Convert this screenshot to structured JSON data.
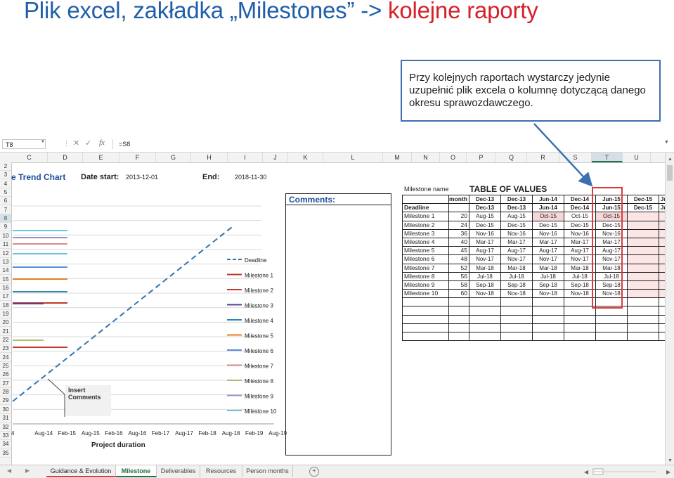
{
  "slide": {
    "title_part1": "Plik excel, zakładka „Milestones” ->",
    "title_part2": "kolejne raporty",
    "callout": "Przy kolejnych raportach wystarczy jedynie uzupełnić plik excela o kolumnę dotyczącą danego okresu sprawozdawczego."
  },
  "formula_bar": {
    "name_box": "T8",
    "fx": "fx",
    "formula": "=S8"
  },
  "columns": [
    "C",
    "D",
    "E",
    "F",
    "G",
    "H",
    "I",
    "J",
    "K",
    "L",
    "M",
    "N",
    "O",
    "P",
    "Q",
    "R",
    "S",
    "T",
    "U"
  ],
  "selected_column": "T",
  "rows": [
    "2",
    "3",
    "4",
    "5",
    "6",
    "7",
    "8",
    "9",
    "10",
    "11",
    "12",
    "13",
    "14",
    "15",
    "16",
    "17",
    "18",
    "19",
    "20",
    "21",
    "22",
    "23",
    "24",
    "25",
    "26",
    "27",
    "28",
    "29",
    "30",
    "31",
    "32",
    "33",
    "34",
    "35"
  ],
  "selected_row": "8",
  "chart": {
    "title": "e Trend Chart",
    "date_start_label": "Date start:",
    "date_start_value": "2013-12-01",
    "date_end_label": "End:",
    "date_end_value": "2018-11-30",
    "x_axis_title": "Project duration",
    "x_ticks": [
      "4",
      "Aug-14",
      "Feb-15",
      "Aug-15",
      "Feb-16",
      "Aug-16",
      "Feb-17",
      "Aug-17",
      "Feb-18",
      "Aug-18",
      "Feb-19",
      "Aug-19"
    ],
    "insert_label": "Insert Comments",
    "legend": [
      {
        "name": "Deadline",
        "color": "#2e75b6",
        "dashed": true
      },
      {
        "name": "Milestone 1",
        "color": "#c0392b"
      },
      {
        "name": "Milestone 2",
        "color": "#c0392b"
      },
      {
        "name": "Milestone 3",
        "color": "#5b3f8c"
      },
      {
        "name": "Milestone 4",
        "color": "#2a8aa8"
      },
      {
        "name": "Milestone 5",
        "color": "#e67e22"
      },
      {
        "name": "Milestone 6",
        "color": "#5b8ed6"
      },
      {
        "name": "Milestone 7",
        "color": "#d98a8a"
      },
      {
        "name": "Milestone 8",
        "color": "#a8c070"
      },
      {
        "name": "Milestone 9",
        "color": "#9b8fc8"
      },
      {
        "name": "Milestone 10",
        "color": "#6cc4d8"
      }
    ]
  },
  "comments": {
    "label": "Comments:"
  },
  "table": {
    "milestone_name_label": "Milestone name",
    "title": "TABLE OF VALUES",
    "header": [
      "",
      "month",
      "Dec-13",
      "Dec-13",
      "Jun-14",
      "Dec-14",
      "Jun-15",
      "Dec-15",
      "Ju"
    ],
    "rows": [
      [
        "Deadline",
        "",
        "Dec-13",
        "Dec-13",
        "Jun-14",
        "Dec-14",
        "Jun-15",
        "Dec-15",
        "Ju"
      ],
      [
        "Milestone 1",
        "20",
        "Aug-15",
        "Aug-15",
        "Oct-15",
        "Oct-15",
        "Oct-15",
        "",
        ""
      ],
      [
        "Milestone 2",
        "24",
        "Dec-15",
        "Dec-15",
        "Dec-15",
        "Dec-15",
        "Dec-15",
        "",
        ""
      ],
      [
        "Milestone 3",
        "36",
        "Nov-16",
        "Nov-16",
        "Nov-16",
        "Nov-16",
        "Nov-16",
        "",
        ""
      ],
      [
        "Milestone 4",
        "40",
        "Mar-17",
        "Mar-17",
        "Mar-17",
        "Mar-17",
        "Mar-17",
        "",
        ""
      ],
      [
        "Milestone 5",
        "45",
        "Aug-17",
        "Aug-17",
        "Aug-17",
        "Aug-17",
        "Aug-17",
        "",
        ""
      ],
      [
        "Milestone 6",
        "48",
        "Nov-17",
        "Nov-17",
        "Nov-17",
        "Nov-17",
        "Nov-17",
        "",
        ""
      ],
      [
        "Milestone 7",
        "52",
        "Mar-18",
        "Mar-18",
        "Mar-18",
        "Mar-18",
        "Mar-18",
        "",
        ""
      ],
      [
        "Milestone 8",
        "56",
        "Jul-18",
        "Jul-18",
        "Jul-18",
        "Jul-18",
        "Jul-18",
        "",
        ""
      ],
      [
        "Milestone 9",
        "58",
        "Sep-18",
        "Sep-18",
        "Sep-18",
        "Sep-18",
        "Sep-18",
        "",
        ""
      ],
      [
        "Milestone 10",
        "60",
        "Nov-18",
        "Nov-18",
        "Nov-18",
        "Nov-18",
        "Nov-18",
        "",
        ""
      ]
    ],
    "empty_rows": 5
  },
  "sheet_tabs": [
    "Guidance & Evolution",
    "Milestone",
    "Deliverables",
    "Resources",
    "Person months"
  ],
  "active_tab": "Milestone"
}
